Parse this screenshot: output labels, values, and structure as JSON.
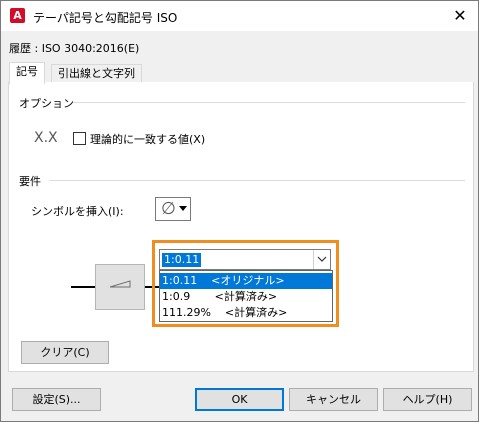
{
  "window": {
    "title": "テーパ記号と勾配記号 ISO",
    "app_icon": "A",
    "close_glyph": "✕"
  },
  "history": "履歴 : ISO 3040:2016(E)",
  "tabs": [
    {
      "label": "記号",
      "active": true
    },
    {
      "label": "引出線と文字列",
      "active": false
    }
  ],
  "options": {
    "heading": "オプション",
    "xx_text": "X.X",
    "checkbox_label": "理論的に一致する値(X)",
    "checkbox_checked": false
  },
  "requirements": {
    "heading": "要件",
    "insert_symbol_label": "シンボルを挿入(I):",
    "symbol_glyph": "∅"
  },
  "value_combo": {
    "current": "1:0.11",
    "options": [
      {
        "text": "1:0.11    <オリジナル>",
        "selected": true
      },
      {
        "text": "1:0.9       <計算済み>",
        "selected": false
      },
      {
        "text": "111.29%    <計算済み>",
        "selected": false
      }
    ]
  },
  "clear_button": "クリア(C)",
  "footer": {
    "settings": "設定(S)...",
    "ok": "OK",
    "cancel": "キャンセル",
    "help": "ヘルプ(H)"
  },
  "colors": {
    "highlight": "#0078d7",
    "callout": "#f08d1e",
    "brand": "#d10d2a"
  }
}
